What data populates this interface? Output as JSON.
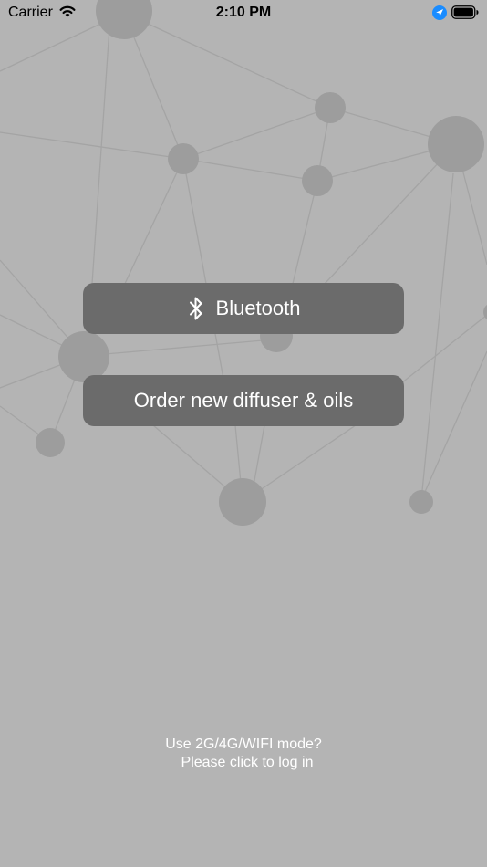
{
  "status_bar": {
    "carrier": "Carrier",
    "time": "2:10 PM",
    "wifi_icon": "wifi-icon",
    "location_icon": "location-arrow-icon",
    "battery_icon": "battery-icon"
  },
  "actions": {
    "bluetooth_label": "Bluetooth",
    "bluetooth_icon": "bluetooth-icon",
    "order_label": "Order new diffuser & oils"
  },
  "footer": {
    "prompt": "Use 2G/4G/WIFI mode?",
    "login_link": "Please click to log in"
  },
  "colors": {
    "background": "#b4b4b4",
    "button": "#6b6b6b",
    "button_text": "#ffffff",
    "node": "#9d9d9d",
    "edge": "#a3a3a3",
    "location_accent": "#1a8cff"
  }
}
